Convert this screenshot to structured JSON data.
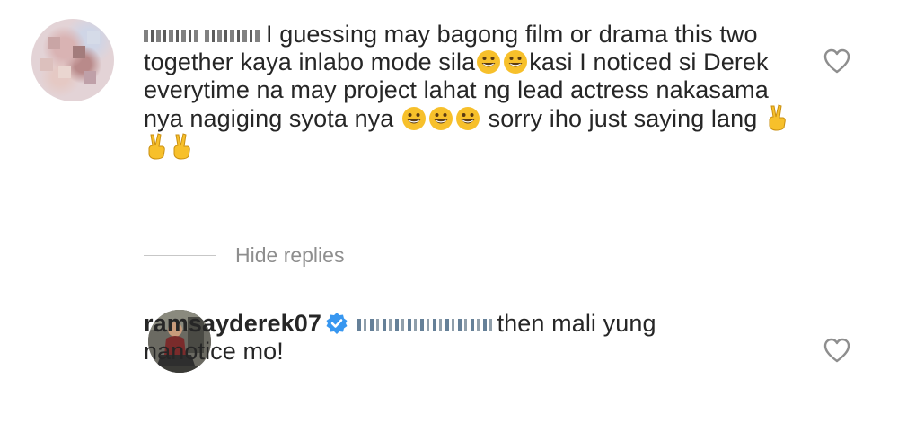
{
  "comments": [
    {
      "username": "",
      "text_line1": "I guessing may bagong film or drama this two",
      "text_line2a": "together kaya inlabo mode sila",
      "text_line2b": "kasi I noticed si Derek",
      "text_line3": "everytime na may project lahat ng lead actress nakasama",
      "text_line4a": "nya nagiging syota nya",
      "text_line4b": "sorry iho just saying lang",
      "emojis": [
        "grinning-face-icon",
        "peace-hand-icon"
      ],
      "like_icon": "heart-outline-icon"
    }
  ],
  "replies": {
    "toggle_label": "Hide replies",
    "items": [
      {
        "username": "ramsayderek07",
        "verified": true,
        "text_a": "then mali yung",
        "text_b": "nanotice mo!",
        "like_icon": "heart-outline-icon"
      }
    ]
  },
  "colors": {
    "text": "#262626",
    "muted": "#8e8e8e",
    "verified_blue": "#3897f0",
    "emoji_yellow": "#f7c02b"
  }
}
